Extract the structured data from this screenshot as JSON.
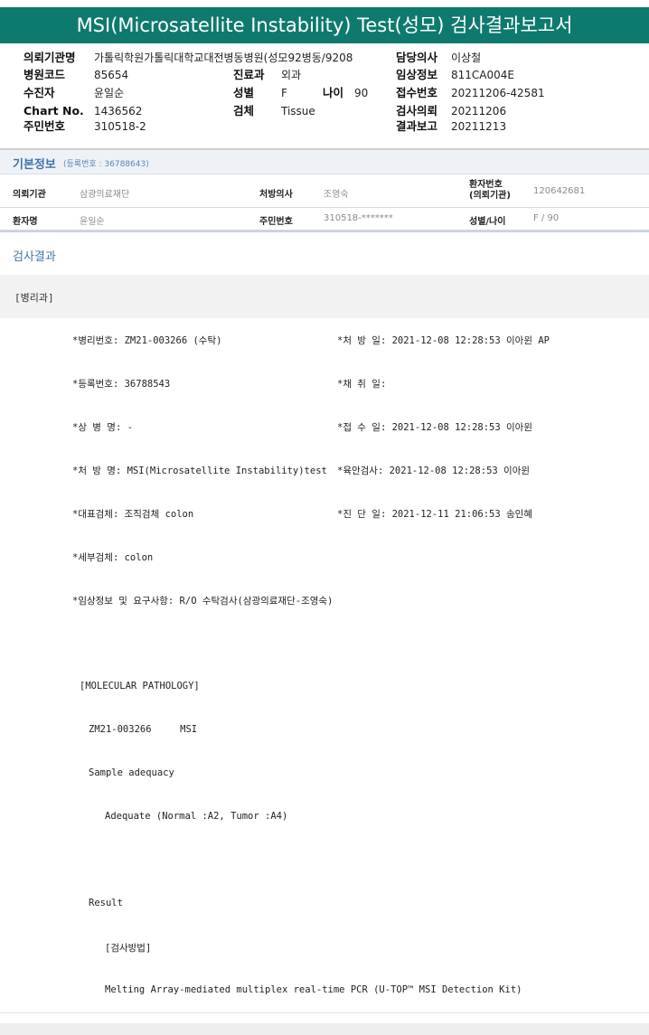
{
  "title": "MSI(Microsatellite Instability) Test(성모) 검사결과보고서",
  "header": {
    "institution_label": "의뢰기관명",
    "institution_value": "가톨릭학원가톨릭대학교대전병동병원(성모92병동/9208",
    "doctor_label": "담당의사",
    "doctor_value": "이상철",
    "hospital_code_label": "병원코드",
    "hospital_code_value": "85654",
    "dept_label": "진료과",
    "dept_value": "외과",
    "clinical_label": "임상정보",
    "clinical_value": "811CA004E",
    "patient_label": "수진자",
    "patient_value": "윤일순",
    "sex_label": "성별",
    "sex_value": "F",
    "age_label": "나이",
    "age_value": "90",
    "receipt_no_label": "접수번호",
    "receipt_no_value": "20211206-42581",
    "chart_label": "Chart No.",
    "chart_value": "1436562",
    "specimen_label": "검체",
    "specimen_value": "Tissue",
    "request_label": "검사의뢰",
    "request_value": "20211206",
    "rrn_label": "주민번호",
    "rrn_value": "310518-2",
    "report_label": "결과보고",
    "report_value": "20211213"
  },
  "basic_info": {
    "title": "기본정보",
    "subtitle": "(등록번호 : 36788643)",
    "row1": {
      "inst_label": "의뢰기관",
      "inst_value": "삼광의료재단",
      "prescriber_label": "처방의사",
      "prescriber_value": "조영숙",
      "patient_no_label": "환자번호\n(의뢰기관)",
      "patient_no_value": "120642681"
    },
    "row2": {
      "name_label": "환자명",
      "name_value": "윤일순",
      "rrn_label": "주민번호",
      "rrn_value": "310518-*******",
      "sexage_label": "성별/나이",
      "sexage_value": "F / 90"
    }
  },
  "results": {
    "title": "검사결과",
    "department": "[병리과]",
    "rows": [
      {
        "left": "*병리번호: ZM21-003266 (수탁)",
        "right": "*처 방 일: 2021-12-08 12:28:53  이아윈 AP"
      },
      {
        "left": "*등록번호: 36788543",
        "right": "*채 취 일:"
      },
      {
        "left": "*상 병 명: -",
        "right": "*접 수 일: 2021-12-08 12:28:53  이아윈"
      },
      {
        "left": "*처 방 명: MSI(Microsatellite Instability)test",
        "right": "*육안검사: 2021-12-08 12:28:53  이아윈"
      },
      {
        "left": "*대표검체: 조직검체 colon",
        "right": "*진 단 일: 2021-12-11 21:06:53  송인혜"
      },
      {
        "left": "*세부검체: colon",
        "right": ""
      },
      {
        "left": "*임상정보 및 요구사항: R/O 수탁검사(삼광의료재단-조영숙)",
        "right": ""
      },
      {
        "left": "",
        "right": ""
      },
      {
        "left": "[MOLECULAR PATHOLOGY]",
        "right": ""
      },
      {
        "left": "ZM21-003266     MSI",
        "right": ""
      },
      {
        "left": "Sample adequacy",
        "right": ""
      },
      {
        "left": "Adequate (Normal :A2, Tumor :A4)",
        "right": ""
      },
      {
        "left": "",
        "right": ""
      },
      {
        "left": "Result",
        "right": ""
      },
      {
        "left": "[검사방법]",
        "right": ""
      },
      {
        "left": "Melting Array-mediated multiplex real-time PCR (U-TOP™ MSI Detection Kit)",
        "right": ""
      }
    ]
  }
}
